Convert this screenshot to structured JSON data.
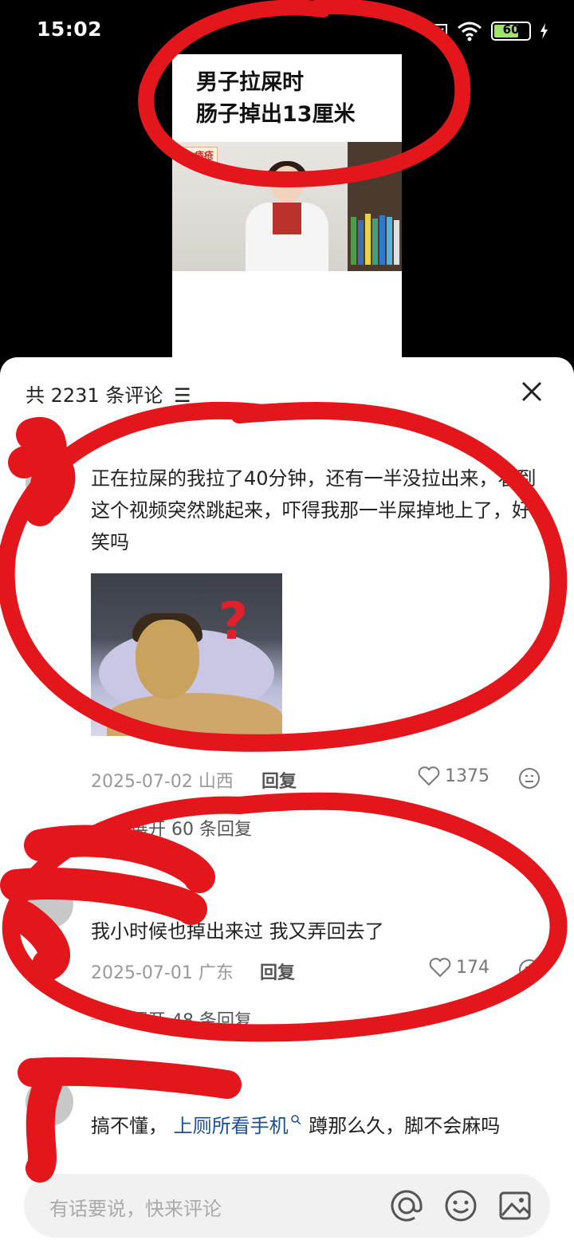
{
  "status_bar": {
    "time": "15:02",
    "battery": "60"
  },
  "video": {
    "title_line1": "男子拉屎时",
    "title_line2": "肠子掉出13厘米",
    "thumb_tag": "1.痔疮"
  },
  "comments_header": {
    "count_label": "共 2231 条评论"
  },
  "comments": [
    {
      "text": "正在拉屎的我拉了40分钟，还有一半没拉出来，看到这个视频突然跳起来，吓得我那一半屎掉地上了，好笑吗",
      "date": "2025-07-02",
      "location": "山西",
      "reply_label": "回复",
      "likes": "1375",
      "expand_label": "展开 60 条回复"
    },
    {
      "text": "我小时候也掉出来过 我又弄回去了",
      "date": "2025-07-01",
      "location": "广东",
      "reply_label": "回复",
      "likes": "174",
      "expand_label": "展开 48 条回复"
    },
    {
      "text_before": "搞不懂，",
      "link": "上厕所看手机",
      "text_after": "蹲那么久，脚不会麻吗"
    }
  ],
  "input_bar": {
    "placeholder": "有话要说，快来评论"
  },
  "icons": [
    "wifi-icon",
    "battery-icon",
    "close-icon",
    "heart-icon",
    "emoji-icon",
    "search-icon",
    "at-icon",
    "image-icon"
  ]
}
